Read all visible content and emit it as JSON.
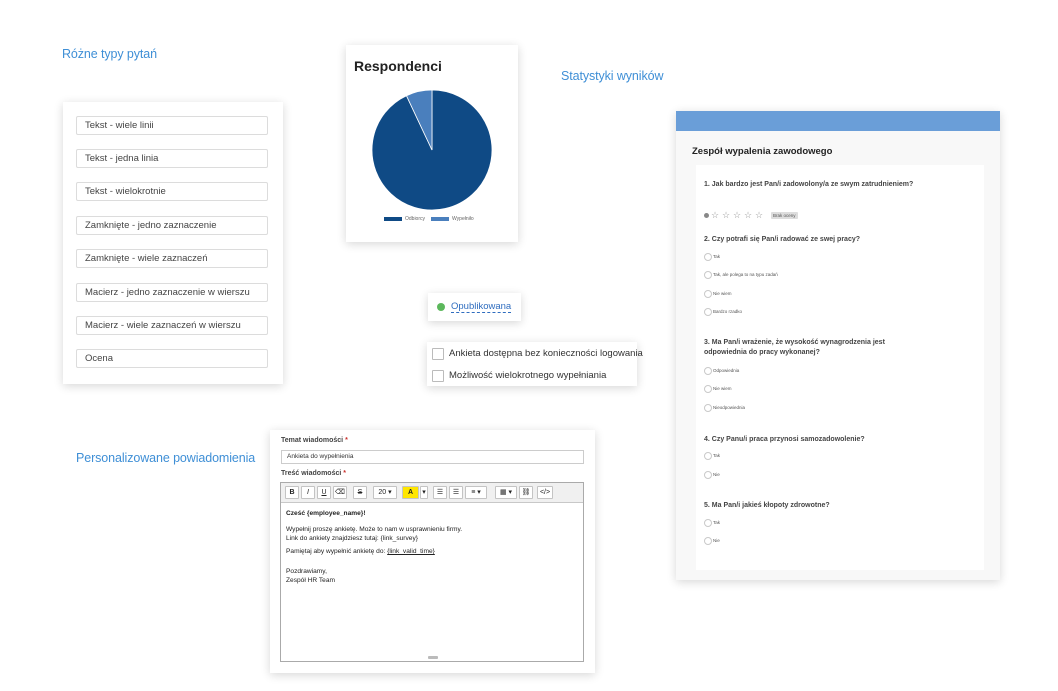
{
  "captions": {
    "question_types": "Różne typy pytań",
    "statistics": "Statystyki wyników",
    "notifications": "Personalizowane powiadomienia"
  },
  "question_types": [
    "Tekst - wiele linii",
    "Tekst - jedna linia",
    "Tekst - wielokrotnie",
    "Zamknięte - jedno zaznaczenie",
    "Zamknięte - wiele zaznaczeń",
    "Macierz - jedno zaznaczenie w wierszu",
    "Macierz - wiele zaznaczeń w wierszu",
    "Ocena"
  ],
  "chart_data": {
    "type": "pie",
    "title": "Respondenci",
    "labels": [
      "Odbiorcy",
      "Wypełniło"
    ],
    "values": [
      93,
      7
    ],
    "colors": [
      "#0f4a85",
      "#4a7fbd"
    ],
    "legend": "bottom"
  },
  "status": {
    "label": "Opublikowana",
    "color": "#5cb85c"
  },
  "options": [
    {
      "label": "Ankieta dostępna bez konieczności logowania",
      "checked": false
    },
    {
      "label": "Możliwość wielokrotnego wypełniania",
      "checked": false
    }
  ],
  "notification": {
    "subject_label": "Temat wiadomości",
    "subject_value": "Ankieta do wypełnienia",
    "body_label": "Treść wiadomości",
    "required_mark": "*",
    "toolbar": {
      "bold": "B",
      "italic": "I",
      "underline": "U",
      "eraser": "⌫",
      "strike": "S",
      "font_size": "20",
      "font_color": "A",
      "bullet_list": "☰",
      "numbered_list": "☰",
      "align": "≡",
      "table": "▦",
      "link": "⛓",
      "code": "</>"
    },
    "body": {
      "greeting": "Cześć {employee_name}!",
      "line1": "Wypełnij proszę ankietę. Może to nam w usprawnieniu firmy.",
      "line2": "Link do ankiety znajdziesz tutaj: {link_survey}",
      "line3_prefix": "Pamiętaj aby wypełnić ankietę do: ",
      "line3_link": "{link_valid_time}",
      "closing": "Pozdrawiamy,",
      "signature": "Zespół HR Team"
    }
  },
  "survey": {
    "title": "Zespół wypalenia zawodowego",
    "no_rating": "Brak oceny",
    "questions": [
      {
        "title": "1. Jak bardzo jest Pan/i zadowolony/a ze swym zatrudnieniem?",
        "type": "rating",
        "stars": 5
      },
      {
        "title": "2. Czy potrafi się Pan/i radować ze swej pracy?",
        "options": [
          "Tak",
          "Tak, ale polega to na typu zadań",
          "Nie wiem",
          "Bardzo rzadko"
        ]
      },
      {
        "title": "3. Ma Pan/i wrażenie, że wysokość wynagrodzenia jest odpowiednia do pracy wykonanej?",
        "options": [
          "Odpowiednia",
          "Nie wiem",
          "Nieodpowiednia"
        ]
      },
      {
        "title": "4. Czy Panu/i praca przynosi samozadowolenie?",
        "options": [
          "Tak",
          "Nie"
        ]
      },
      {
        "title": "5. Ma Pan/i jakieś kłopoty zdrowotne?",
        "options": [
          "Tak",
          "Nie"
        ]
      }
    ]
  }
}
